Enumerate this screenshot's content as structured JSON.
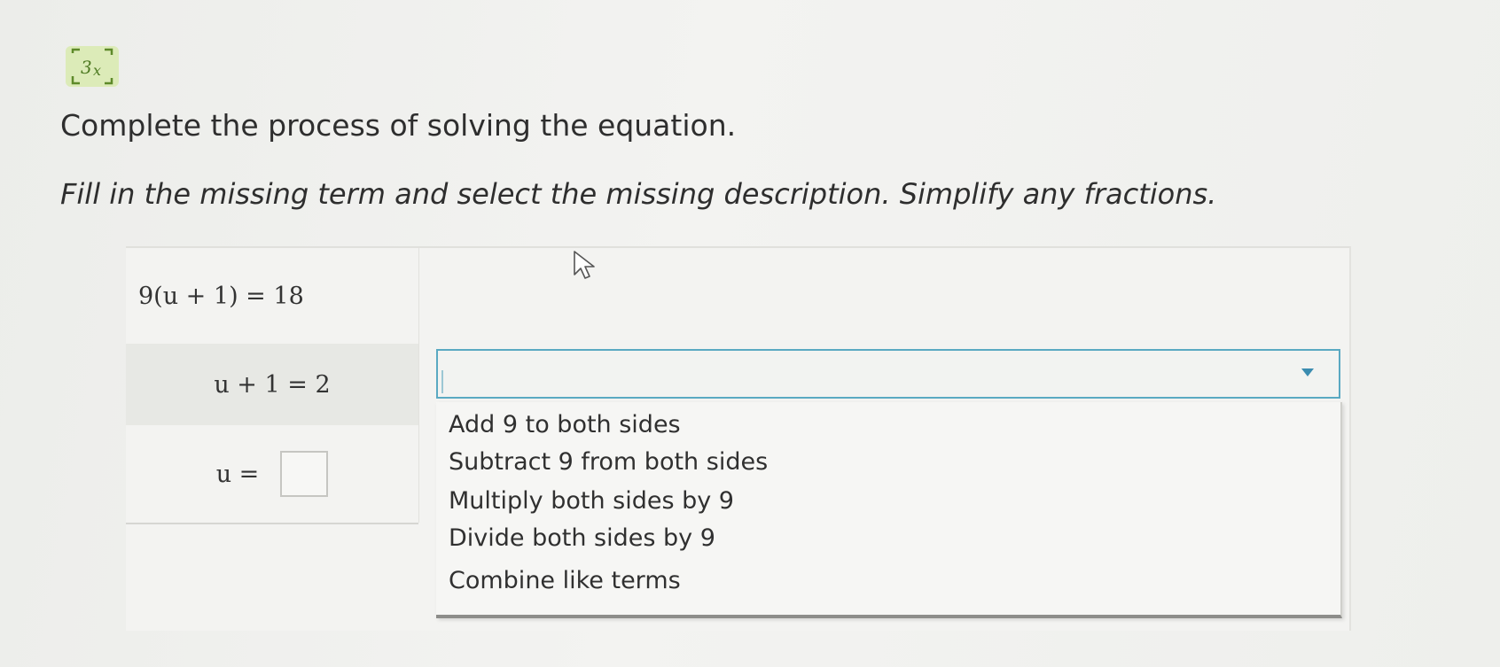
{
  "header": {
    "icon": "equation-solver-icon",
    "title": "Complete the process of solving the equation.",
    "instruction": "Fill in the missing term and select the missing description. Simplify any fractions."
  },
  "steps": {
    "step1": "9(u + 1) = 18",
    "step2": "u + 1 = 2",
    "step3_lhs": "u =",
    "step3_answer": ""
  },
  "description_select": {
    "selected": "",
    "options": [
      "Add 9 to both sides",
      "Subtract 9 from both sides",
      "Multiply both sides by 9",
      "Divide both sides by 9",
      "Combine like terms"
    ]
  },
  "colors": {
    "accent": "#5aa9c2",
    "icon_bg": "#dcebb8"
  }
}
